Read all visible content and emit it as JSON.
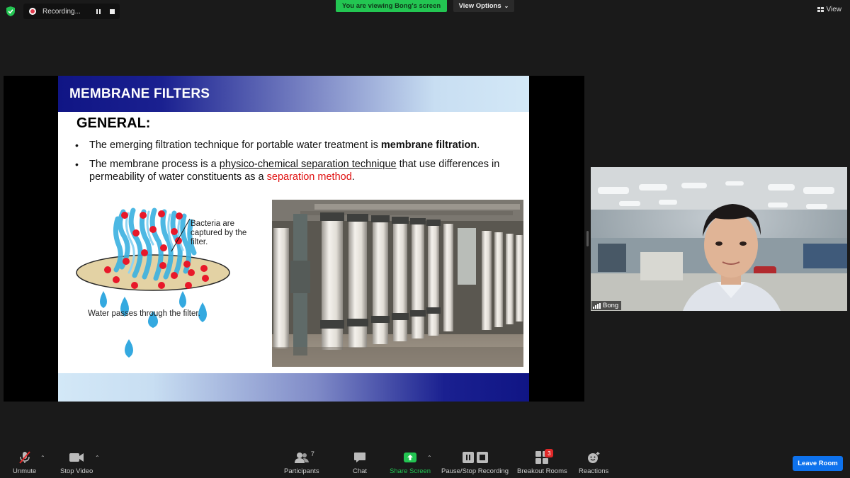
{
  "recording": {
    "label": "Recording..."
  },
  "banner": {
    "viewing": "You are viewing Bong's screen",
    "view_options": "View Options",
    "view_button": "View"
  },
  "slide": {
    "title": "MEMBRANE FILTERS",
    "general": "GENERAL:",
    "bullet1": {
      "pre": "The emerging filtration technique for portable water treatment is ",
      "bold": "membrane filtration",
      "post": "."
    },
    "bullet2": {
      "pre": "The membrane process is a ",
      "underlined": "physico-chemical separation technique",
      "mid": " that use differences in permeability of water constituents as a ",
      "red": "separation method",
      "post": "."
    },
    "caption_bacteria": "Bacteria are captured by the filter.",
    "caption_water": "Water passes through the filter."
  },
  "video": {
    "name": "Bong"
  },
  "toolbar": {
    "unmute": "Unmute",
    "stop_video": "Stop Video",
    "participants": "Participants",
    "participant_count": "7",
    "chat": "Chat",
    "share_screen": "Share Screen",
    "pause_stop_recording": "Pause/Stop Recording",
    "breakout_rooms": "Breakout Rooms",
    "breakout_count": "3",
    "reactions": "Reactions",
    "leave": "Leave Room"
  },
  "colors": {
    "share_green": "#23c552",
    "leave_blue": "#0e72ed",
    "badge_red": "#e02828",
    "slide_red": "#e01010"
  }
}
